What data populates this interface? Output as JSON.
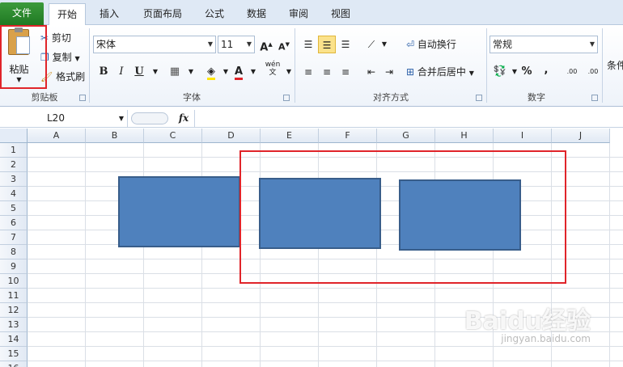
{
  "tabs": [
    {
      "label": "文件",
      "kind": "file"
    },
    {
      "label": "开始",
      "kind": "active"
    },
    {
      "label": "插入",
      "kind": "normal"
    },
    {
      "label": "页面布局",
      "kind": "normal"
    },
    {
      "label": "公式",
      "kind": "normal"
    },
    {
      "label": "数据",
      "kind": "normal"
    },
    {
      "label": "审阅",
      "kind": "normal"
    },
    {
      "label": "视图",
      "kind": "normal"
    }
  ],
  "clipboard": {
    "paste_label": "粘贴",
    "cut_label": "剪切",
    "copy_label": "复制",
    "format_painter_label": "格式刷",
    "group_label": "剪贴板"
  },
  "font": {
    "font_name": "宋体",
    "font_size": "11",
    "bold": "B",
    "italic": "I",
    "underline": "U",
    "grow": "A",
    "shrink": "A",
    "color_glyph": "A",
    "wen_glyph": "wén\n文",
    "group_label": "字体"
  },
  "alignment": {
    "wrap_text_label": "自动换行",
    "merge_center_label": "合并后居中",
    "group_label": "对齐方式"
  },
  "number": {
    "format_value": "常规",
    "percent": "%",
    "comma": ",",
    "inc_decimal": ".00",
    "dec_decimal": ".00",
    "group_label": "数字"
  },
  "styles": {
    "partial_label": "条件"
  },
  "formula_bar": {
    "name_box": "L20",
    "fx": "fx"
  },
  "columns": [
    "A",
    "B",
    "C",
    "D",
    "E",
    "F",
    "G",
    "H",
    "I",
    "J"
  ],
  "rows": [
    "1",
    "2",
    "3",
    "4",
    "5",
    "6",
    "7",
    "8",
    "9",
    "10",
    "11",
    "12",
    "13",
    "14",
    "15",
    "16"
  ],
  "colors": {
    "shape_fill": "#4f81bd",
    "shape_border": "#385d8a",
    "highlight": "#e0242a",
    "file_tab": "#2a8a2e"
  },
  "watermark": {
    "brand": "Baidu经验",
    "url": "jingyan.baidu.com"
  }
}
